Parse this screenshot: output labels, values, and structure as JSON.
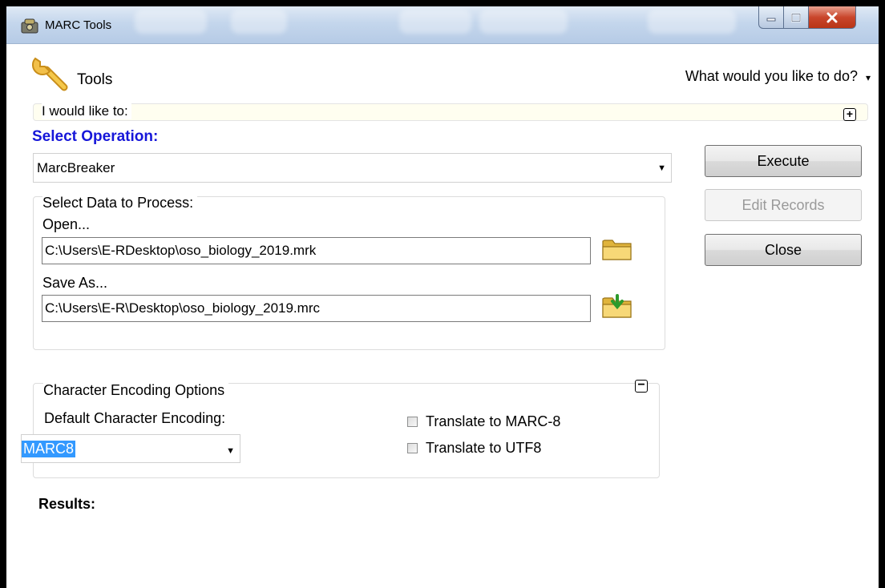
{
  "window": {
    "title": "MARC Tools",
    "controls": {
      "minimize": "minimize",
      "maximize": "maximize",
      "close": "close"
    }
  },
  "toolbar": {
    "label": "Tools",
    "prompt": "What would you like to do?",
    "prompt_arrow": "▾"
  },
  "wizard": {
    "label": "I would like to:",
    "expand_symbol": "+"
  },
  "operation": {
    "heading": "Select Operation:",
    "selected": "MarcBreaker",
    "arrow": "▼"
  },
  "buttons": {
    "execute": "Execute",
    "edit_records": "Edit Records",
    "close": "Close"
  },
  "data_group": {
    "title": "Select Data to Process:",
    "open_label": "Open...",
    "open_path": "C:\\Users\\E-RDesktop\\oso_biology_2019.mrk",
    "save_label": "Save As...",
    "save_path": "C:\\Users\\E-R\\Desktop\\oso_biology_2019.mrc"
  },
  "encoding_group": {
    "title": "Character Encoding Options",
    "collapse_symbol": "−",
    "default_label": "Default Character Encoding:",
    "selected": "MARC8",
    "arrow": "▼",
    "options": [
      {
        "label": "Translate to MARC-8",
        "checked": false
      },
      {
        "label": "Translate to UTF8",
        "checked": false
      }
    ]
  },
  "results": {
    "label": "Results:"
  },
  "colors": {
    "heading_blue": "#1616d9",
    "selection": "#3399ff",
    "title_bar": "#c4d6ec"
  }
}
